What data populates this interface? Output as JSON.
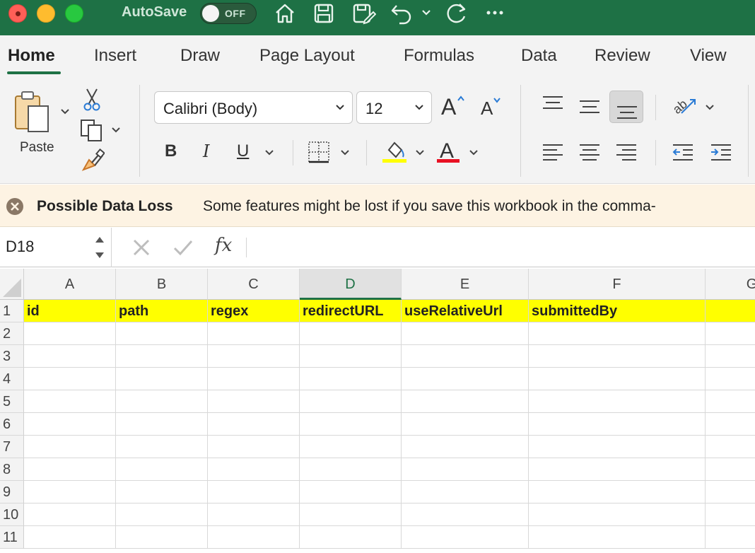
{
  "titlebar": {
    "autosave_label": "AutoSave",
    "autosave_state": "OFF",
    "accent": "#1e7145"
  },
  "ribbon": {
    "tabs": [
      {
        "label": "Home",
        "active": true
      },
      {
        "label": "Insert"
      },
      {
        "label": "Draw"
      },
      {
        "label": "Page Layout"
      },
      {
        "label": "Formulas"
      },
      {
        "label": "Data"
      },
      {
        "label": "Review"
      },
      {
        "label": "View"
      }
    ],
    "paste_label": "Paste",
    "font_name": "Calibri (Body)",
    "font_size": "12",
    "bold": "B",
    "italic": "I",
    "underline": "U",
    "highlight_color": "#ffff00",
    "font_color": "#e81123"
  },
  "message": {
    "title": "Possible Data Loss",
    "text": "Some features might be lost if you save this workbook in the comma-"
  },
  "formula_bar": {
    "name_box": "D18",
    "fx": "fx",
    "formula": ""
  },
  "sheet": {
    "columns": [
      "A",
      "B",
      "C",
      "D",
      "E",
      "F",
      "G"
    ],
    "selected_column": "D",
    "row_numbers": [
      "1",
      "2",
      "3",
      "4",
      "5",
      "6",
      "7",
      "8",
      "9",
      "10",
      "11"
    ],
    "header_row": [
      "id",
      "path",
      "regex",
      "redirectURL",
      "useRelativeUrl",
      "submittedBy",
      ""
    ],
    "header_fill": "#ffff00"
  }
}
